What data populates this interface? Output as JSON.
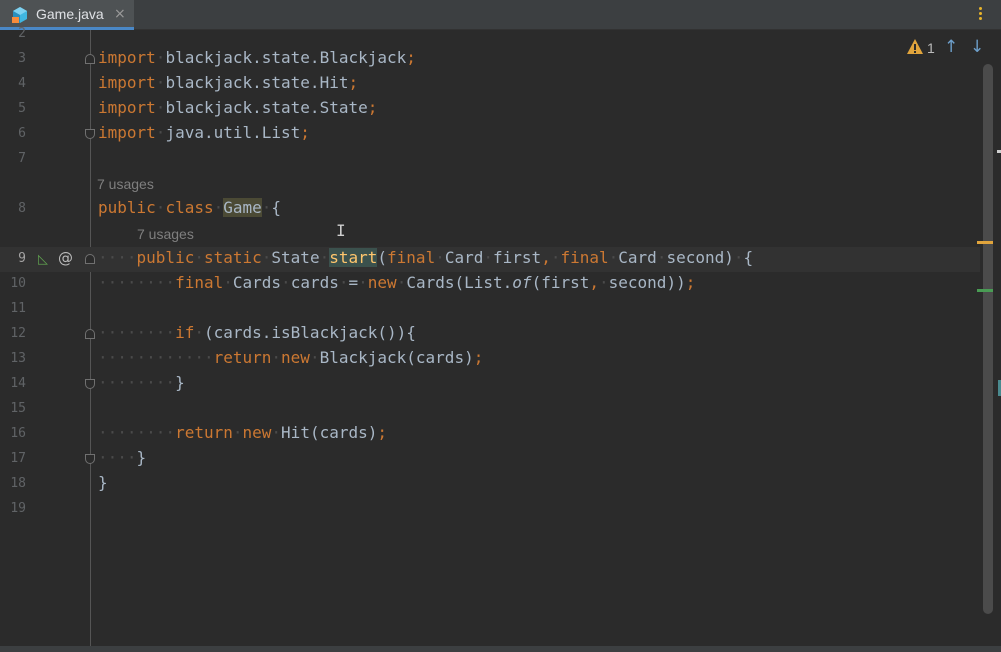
{
  "tab": {
    "file_name": "Game.java",
    "close_glyph": "×",
    "icon": "java-class-icon"
  },
  "inspection": {
    "warning_count": "1",
    "warning_icon": "warning-triangle-icon",
    "up_glyph": "↑",
    "down_glyph": "↓"
  },
  "usages_hint_class": "7 usages",
  "usages_hint_method": "7 usages",
  "line_numbers": [
    "2",
    "3",
    "4",
    "5",
    "6",
    "7",
    "8",
    "9",
    "10",
    "11",
    "12",
    "13",
    "14",
    "15",
    "16",
    "17",
    "18",
    "19"
  ],
  "code_lines": {
    "l3": "import blackjack.state.Blackjack;",
    "l4": "import blackjack.state.Hit;",
    "l5": "import blackjack.state.State;",
    "l6": "import java.util.List;",
    "l8": "public class Game {",
    "l9": "public static State start(final Card first, final Card second) {",
    "l10": "final Cards cards = new Cards(List.of(first, second));",
    "l12": "if (cards.isBlackjack()){",
    "l13": "return new Blackjack(cards);",
    "l14": "}",
    "l16": "return new Hit(cards);",
    "l17": "}",
    "l18": "}"
  },
  "gutter": {
    "at_symbol": "@"
  },
  "colors": {
    "background": "#2b2b2b",
    "keyword": "#cc7832",
    "default_text": "#a9b7c6",
    "method": "#ffc66d",
    "warning": "#e0a43c"
  }
}
